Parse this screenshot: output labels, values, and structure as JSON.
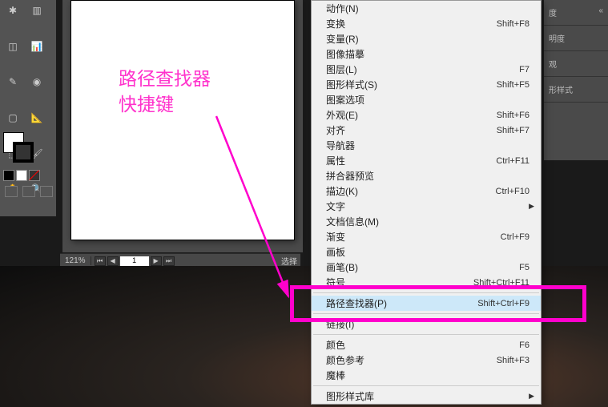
{
  "annotation": {
    "line1": "路径查找器",
    "line2": "快捷键"
  },
  "status": {
    "zoom": "121%",
    "page": "1",
    "select_label": "选择"
  },
  "right_panel": {
    "sect1": "度",
    "sect2": "明度",
    "sect3": "观",
    "sect4": "形样式"
  },
  "menu": {
    "items": [
      {
        "label": "动作(N)",
        "shortcut": "",
        "disabled": false,
        "arrow": false
      },
      {
        "label": "变换",
        "shortcut": "Shift+F8",
        "disabled": false,
        "arrow": false
      },
      {
        "label": "变量(R)",
        "shortcut": "",
        "disabled": false,
        "arrow": false
      },
      {
        "label": "图像描摹",
        "shortcut": "",
        "disabled": false,
        "arrow": false
      },
      {
        "label": "图层(L)",
        "shortcut": "F7",
        "disabled": false,
        "arrow": false
      },
      {
        "label": "图形样式(S)",
        "shortcut": "Shift+F5",
        "disabled": false,
        "arrow": false
      },
      {
        "label": "图案选项",
        "shortcut": "",
        "disabled": false,
        "arrow": false
      },
      {
        "label": "外观(E)",
        "shortcut": "Shift+F6",
        "disabled": false,
        "arrow": false
      },
      {
        "label": "对齐",
        "shortcut": "Shift+F7",
        "disabled": false,
        "arrow": false
      },
      {
        "label": "导航器",
        "shortcut": "",
        "disabled": false,
        "arrow": false
      },
      {
        "label": "属性",
        "shortcut": "Ctrl+F11",
        "disabled": false,
        "arrow": false
      },
      {
        "label": "拼合器预览",
        "shortcut": "",
        "disabled": false,
        "arrow": false
      },
      {
        "label": "描边(K)",
        "shortcut": "Ctrl+F10",
        "disabled": false,
        "arrow": false
      },
      {
        "label": "文字",
        "shortcut": "",
        "disabled": false,
        "arrow": true
      },
      {
        "label": "文档信息(M)",
        "shortcut": "",
        "disabled": false,
        "arrow": false
      },
      {
        "label": "渐变",
        "shortcut": "Ctrl+F9",
        "disabled": false,
        "arrow": false
      },
      {
        "label": "画板",
        "shortcut": "",
        "disabled": false,
        "arrow": false
      },
      {
        "label": "画笔(B)",
        "shortcut": "F5",
        "disabled": false,
        "arrow": false
      },
      {
        "label": "符号",
        "shortcut": "Shift+Ctrl+F11",
        "disabled": false,
        "arrow": false
      }
    ],
    "pathfinder": {
      "label": "路径查找器(P)",
      "shortcut": "Shift+Ctrl+F9"
    },
    "links": {
      "label": "链接(I)",
      "shortcut": ""
    },
    "after": [
      {
        "label": "颜色",
        "shortcut": "F6",
        "disabled": false
      },
      {
        "label": "颜色参考",
        "shortcut": "Shift+F3",
        "disabled": false
      },
      {
        "label": "魔棒",
        "shortcut": "",
        "disabled": false
      }
    ],
    "stylelib": {
      "label": "图形样式库",
      "arrow": true
    }
  }
}
